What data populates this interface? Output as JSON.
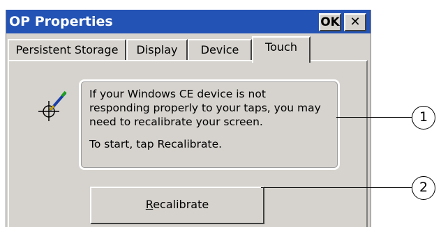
{
  "window": {
    "title": "OP Properties",
    "ok_label": "OK",
    "close_glyph": "✕"
  },
  "tabs": [
    {
      "label": "Persistent Storage",
      "active": false
    },
    {
      "label": "Display",
      "active": false
    },
    {
      "label": "Device",
      "active": false
    },
    {
      "label": "Touch",
      "active": true
    }
  ],
  "touch_panel": {
    "icon": "stylus-crosshair-icon",
    "info_line1": "If your Windows CE device is not responding properly to your taps, you may need to recalibrate your screen.",
    "info_line2": "To start, tap Recalibrate.",
    "recalibrate_accel": "R",
    "recalibrate_rest": "ecalibrate"
  },
  "callouts": [
    "1",
    "2"
  ],
  "colors": {
    "titlebar": "#2353b4",
    "window_face": "#d6d3ce",
    "title_text": "#ffffff"
  }
}
